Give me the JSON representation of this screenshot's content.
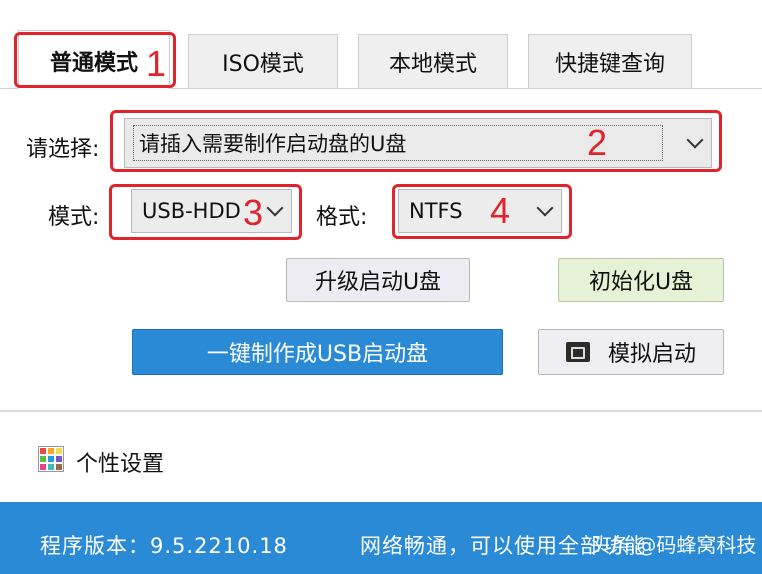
{
  "tabs": [
    {
      "label": "普通模式",
      "active": true
    },
    {
      "label": "ISO模式",
      "active": false
    },
    {
      "label": "本地模式",
      "active": false
    },
    {
      "label": "快捷键查询",
      "active": false
    }
  ],
  "device": {
    "label": "请选择:",
    "value": "请插入需要制作启动盘的U盘"
  },
  "mode": {
    "label": "模式:",
    "value": "USB-HDD"
  },
  "format": {
    "label": "格式:",
    "value": "NTFS"
  },
  "buttons": {
    "upgrade": "升级启动U盘",
    "initialize": "初始化U盘",
    "make": "一键制作成USB启动盘",
    "simulate": "模拟启动"
  },
  "personalize": {
    "label": "个性设置"
  },
  "status": {
    "version": "程序版本：9.5.2210.18",
    "network": "网络畅通，可以使用全部功能"
  },
  "annotations": {
    "n1": "1",
    "n2": "2",
    "n3": "3",
    "n4": "4",
    "color": "#e0242c"
  },
  "watermark": {
    "label": "头条 @码蜂窝科技"
  },
  "colors": {
    "accent_blue": "#2a8ad6",
    "green_button": "#e5f2d6"
  }
}
